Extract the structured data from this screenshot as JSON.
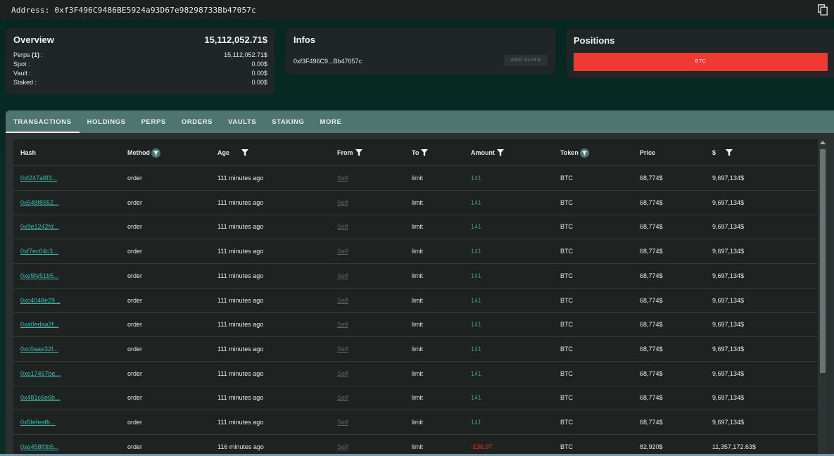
{
  "address_bar": {
    "text": "Address: 0xf3F496C9486BE5924a93D67e98298733Bb47057c",
    "copy_icon": "copy-icon"
  },
  "overview": {
    "title": "Overview",
    "total": "15,112,052.71$",
    "perps_label": "Perps",
    "perps_count": "(1)",
    "perps_suffix": " :",
    "perps_value": "15,112,052.71$",
    "spot_label": "Spot :",
    "spot_value": "0.00$",
    "vault_label": "Vault :",
    "vault_value": "0.00$",
    "staked_label": "Staked :",
    "staked_value": "0.00$"
  },
  "infos": {
    "title": "Infos",
    "address_short": "0xf3F496C9...Bb47057c",
    "add_alias_label": "ADD ALIAS"
  },
  "positions": {
    "title": "Positions",
    "items": [
      {
        "label": "BTC",
        "color": "#f03a31"
      }
    ]
  },
  "tabs": [
    {
      "label": "TRANSACTIONS",
      "active": true
    },
    {
      "label": "HOLDINGS"
    },
    {
      "label": "PERPS"
    },
    {
      "label": "ORDERS"
    },
    {
      "label": "VAULTS"
    },
    {
      "label": "STAKING"
    },
    {
      "label": "MORE"
    }
  ],
  "table": {
    "columns": [
      "Hash",
      "Method",
      "Age",
      "From",
      "To",
      "Amount",
      "Token",
      "Price",
      "$"
    ],
    "rows": [
      {
        "hash": "0xf247a8f3...",
        "method": "order",
        "age": "111 minutes ago",
        "from": "Self",
        "to": "limit",
        "amount": "141",
        "token": "BTC",
        "price": "68,774$",
        "usd": "9,697,134$"
      },
      {
        "hash": "0x548f8552...",
        "method": "order",
        "age": "111 minutes ago",
        "from": "Self",
        "to": "limit",
        "amount": "141",
        "token": "BTC",
        "price": "68,774$",
        "usd": "9,697,134$"
      },
      {
        "hash": "0x9e1242fd...",
        "method": "order",
        "age": "111 minutes ago",
        "from": "Self",
        "to": "limit",
        "amount": "141",
        "token": "BTC",
        "price": "68,774$",
        "usd": "9,697,134$"
      },
      {
        "hash": "0xf7ec04c3...",
        "method": "order",
        "age": "111 minutes ago",
        "from": "Self",
        "to": "limit",
        "amount": "141",
        "token": "BTC",
        "price": "68,774$",
        "usd": "9,697,134$"
      },
      {
        "hash": "0xe5fe51b5...",
        "method": "order",
        "age": "111 minutes ago",
        "from": "Self",
        "to": "limit",
        "amount": "141",
        "token": "BTC",
        "price": "68,774$",
        "usd": "9,697,134$"
      },
      {
        "hash": "0xc4048e29...",
        "method": "order",
        "age": "111 minutes ago",
        "from": "Self",
        "to": "limit",
        "amount": "141",
        "token": "BTC",
        "price": "68,774$",
        "usd": "9,697,134$"
      },
      {
        "hash": "0xa0edaa2f...",
        "method": "order",
        "age": "111 minutes ago",
        "from": "Self",
        "to": "limit",
        "amount": "141",
        "token": "BTC",
        "price": "68,774$",
        "usd": "9,697,134$"
      },
      {
        "hash": "0xc0aae32f...",
        "method": "order",
        "age": "111 minutes ago",
        "from": "Self",
        "to": "limit",
        "amount": "141",
        "token": "BTC",
        "price": "68,774$",
        "usd": "9,697,134$"
      },
      {
        "hash": "0xe17457be...",
        "method": "order",
        "age": "111 minutes ago",
        "from": "Self",
        "to": "limit",
        "amount": "141",
        "token": "BTC",
        "price": "68,774$",
        "usd": "9,697,134$"
      },
      {
        "hash": "0x481c6e6b...",
        "method": "order",
        "age": "111 minutes ago",
        "from": "Self",
        "to": "limit",
        "amount": "141",
        "token": "BTC",
        "price": "68,774$",
        "usd": "9,697,134$"
      },
      {
        "hash": "0x5fefeafb...",
        "method": "order",
        "age": "111 minutes ago",
        "from": "Self",
        "to": "limit",
        "amount": "141",
        "token": "BTC",
        "price": "68,774$",
        "usd": "9,697,134$"
      },
      {
        "hash": "0xe458f0b5...",
        "method": "order",
        "age": "116 minutes ago",
        "from": "Self",
        "to": "limit",
        "amount": "-136.97",
        "token": "BTC",
        "price": "82,920$",
        "usd": "11,357,172.63$"
      }
    ]
  },
  "colors": {
    "accent_link": "#3fb8b0",
    "amount_positive": "#2fa24a",
    "amount_negative": "#e53a2f",
    "tab_bar": "#4f7570"
  }
}
